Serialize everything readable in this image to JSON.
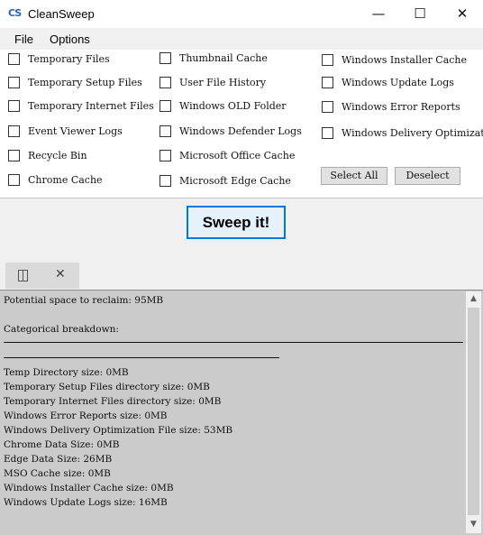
{
  "window": {
    "icon_text": "CS",
    "title": "CleanSweep",
    "minimize": "—",
    "maximize": "☐",
    "close": "✕"
  },
  "menu": {
    "file": "File",
    "options": "Options"
  },
  "options": {
    "col1": [
      "Temporary Files",
      "Temporary Setup Files",
      "Temporary Internet Files",
      "Event Viewer Logs",
      "Recycle Bin",
      "Chrome Cache"
    ],
    "col2": [
      "Thumbnail Cache",
      "User File History",
      "Windows OLD Folder",
      "Windows Defender Logs",
      "Microsoft Office Cache",
      "Microsoft Edge Cache"
    ],
    "col3": [
      "Windows Installer Cache",
      "Windows Update Logs",
      "Windows Error Reports",
      "Windows Delivery Optimization"
    ],
    "select_all": "Select All",
    "deselect": "Deselect"
  },
  "sweep_button": "Sweep it!",
  "tab": {
    "close": "✕"
  },
  "output": {
    "potential": "Potential space to reclaim: 95MB",
    "breakdown_heading": "Categorical breakdown:",
    "lines": [
      "Temp Directory size: 0MB",
      "Temporary Setup Files directory size: 0MB",
      "Temporary Internet Files directory size: 0MB",
      "Windows Error Reports size: 0MB",
      "Windows Delivery Optimization File size: 53MB",
      "Chrome Data Size: 0MB",
      "Edge Data Size: 26MB",
      "MSO Cache size: 0MB",
      "Windows Installer Cache size: 0MB",
      "Windows Update Logs size: 16MB"
    ]
  },
  "scrollbar": {
    "up": "▲",
    "down": "▼"
  }
}
